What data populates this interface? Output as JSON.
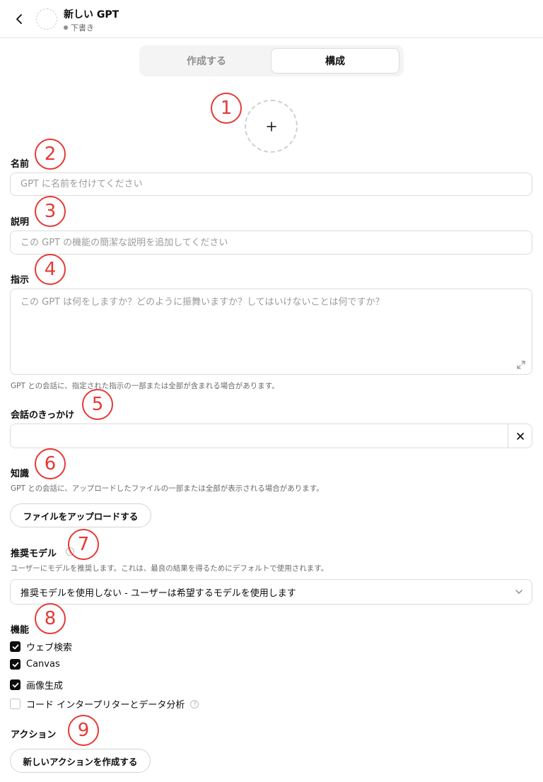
{
  "header": {
    "title": "新しい GPT",
    "status": "下書き"
  },
  "tabs": {
    "create": "作成する",
    "configure": "構成"
  },
  "avatar": {
    "icon": "plus-icon"
  },
  "name": {
    "label": "名前",
    "placeholder": "GPT に名前を付けてください"
  },
  "description": {
    "label": "説明",
    "placeholder": "この GPT の機能の簡潔な説明を追加してください"
  },
  "instructions": {
    "label": "指示",
    "placeholder": "この GPT は何をしますか？どのように振舞いますか？してはいけないことは何ですか？",
    "hint": "GPT との会話に、指定された指示の一部または全部が含まれる場合があります。"
  },
  "starters": {
    "label": "会話のきっかけ",
    "value": ""
  },
  "knowledge": {
    "label": "知識",
    "hint": "GPT との会話に、アップロードしたファイルの一部または全部が表示される場合があります。",
    "upload_button": "ファイルをアップロードする"
  },
  "recommended_model": {
    "label": "推奨モデル",
    "hint": "ユーザーにモデルを推奨します。これは、最良の結果を得るためにデフォルトで使用されます。",
    "selected": "推奨モデルを使用しない - ユーザーは希望するモデルを使用します"
  },
  "capabilities": {
    "label": "機能",
    "items": [
      {
        "label": "ウェブ検索",
        "checked": true
      },
      {
        "label": "Canvas",
        "checked": true
      },
      {
        "label": "画像生成",
        "checked": true
      },
      {
        "label": "コード インタープリターとデータ分析",
        "checked": false
      }
    ]
  },
  "actions": {
    "label": "アクション",
    "create_button": "新しいアクションを作成する"
  },
  "markers": [
    "1",
    "2",
    "3",
    "4",
    "5",
    "6",
    "7",
    "8",
    "9"
  ],
  "colors": {
    "marker": "#e53935",
    "border": "#dcdcdc",
    "checkbox": "#0d0d0d"
  }
}
